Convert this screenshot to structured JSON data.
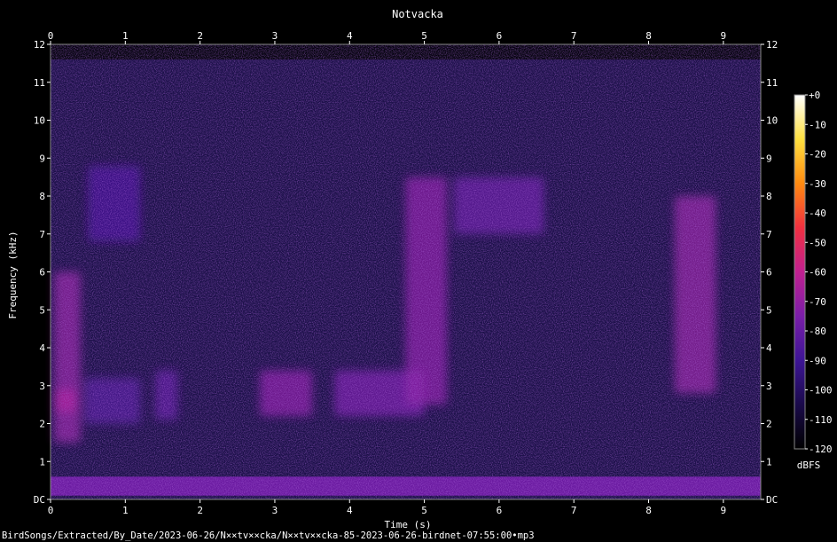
{
  "chart_data": {
    "type": "heatmap",
    "title": "Notvacka",
    "xlabel": "Time (s)",
    "ylabel": "Frequency (kHz)",
    "x_ticks": [
      0,
      1,
      2,
      3,
      4,
      5,
      6,
      7,
      8,
      9
    ],
    "y_ticks": [
      "DC",
      "1",
      "2",
      "3",
      "4",
      "5",
      "6",
      "7",
      "8",
      "9",
      "10",
      "11",
      "12"
    ],
    "xlim": [
      0,
      9.5
    ],
    "ylim": [
      0,
      12
    ],
    "colorbar": {
      "label": "dBFS",
      "range": [
        -120,
        0
      ],
      "ticks": [
        "+0",
        "-10",
        "-20",
        "-30",
        "-40",
        "-50",
        "-60",
        "-70",
        "-80",
        "-90",
        "-100",
        "-110",
        "-120"
      ],
      "colormap": [
        "#000000",
        "#1a0a4a",
        "#3d1595",
        "#7a1ea8",
        "#c02090",
        "#f03040",
        "#ff8a10",
        "#ffe040",
        "#ffffff"
      ]
    },
    "background_level_dbfs": -100,
    "noise_band_khz": [
      0.1,
      0.6
    ],
    "energy_regions": [
      {
        "t": [
          0.05,
          0.4
        ],
        "f": [
          1.5,
          6.0
        ],
        "level_dbfs": -70
      },
      {
        "t": [
          0.05,
          0.35
        ],
        "f": [
          2.3,
          2.9
        ],
        "level_dbfs": -65
      },
      {
        "t": [
          0.45,
          1.2
        ],
        "f": [
          2.0,
          3.2
        ],
        "level_dbfs": -85
      },
      {
        "t": [
          0.5,
          1.2
        ],
        "f": [
          6.8,
          8.8
        ],
        "level_dbfs": -88
      },
      {
        "t": [
          1.4,
          1.7
        ],
        "f": [
          2.1,
          3.4
        ],
        "level_dbfs": -82
      },
      {
        "t": [
          2.8,
          3.5
        ],
        "f": [
          2.2,
          3.4
        ],
        "level_dbfs": -72
      },
      {
        "t": [
          3.8,
          5.0
        ],
        "f": [
          2.2,
          3.4
        ],
        "level_dbfs": -76
      },
      {
        "t": [
          4.75,
          5.3
        ],
        "f": [
          2.5,
          8.5
        ],
        "level_dbfs": -72
      },
      {
        "t": [
          5.4,
          6.6
        ],
        "f": [
          7.0,
          8.5
        ],
        "level_dbfs": -80
      },
      {
        "t": [
          8.35,
          8.9
        ],
        "f": [
          2.8,
          8.0
        ],
        "level_dbfs": -70
      }
    ],
    "footer": "BirdSongs/Extracted/By_Date/2023-06-26/N××tv××cka/N××tv××cka-85-2023-06-26-birdnet-07:55:00•mp3"
  }
}
